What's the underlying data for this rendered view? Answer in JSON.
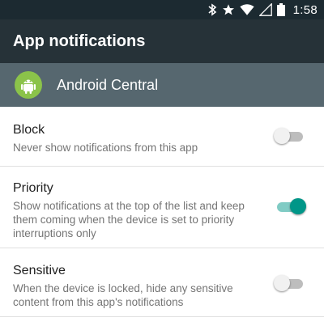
{
  "status_bar": {
    "time": "1:58",
    "icons": [
      "bluetooth-icon",
      "star-icon",
      "wifi-icon",
      "signal-icon",
      "battery-icon"
    ]
  },
  "app_bar": {
    "title": "App notifications"
  },
  "app_header": {
    "app_name": "Android Central",
    "icon": "android-central-logo"
  },
  "settings": [
    {
      "title": "Block",
      "description": "Never show notifications from this app",
      "enabled": false
    },
    {
      "title": "Priority",
      "description": "Show notifications at the top of the list and keep them coming when the device is set to priority interruptions only",
      "enabled": true
    },
    {
      "title": "Sensitive",
      "description": "When the device is locked, hide any sensitive content from this app's notifications",
      "enabled": false
    }
  ],
  "colors": {
    "status_bar": "#1c2a31",
    "app_bar": "#263238",
    "app_header": "#56676f",
    "accent": "#009688",
    "app_icon": "#8bc34a"
  }
}
